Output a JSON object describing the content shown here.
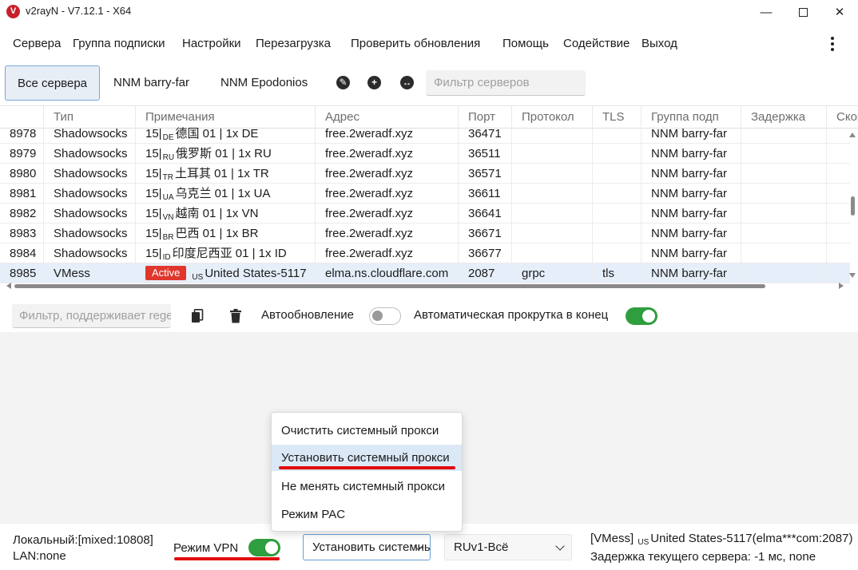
{
  "window": {
    "title": "v2rayN - V7.12.1 - X64",
    "logo_glyph": "V",
    "minimize": "—",
    "close": "✕"
  },
  "menu": {
    "items": [
      "Сервера",
      "Группа подписки",
      "Настройки",
      "Перезагрузка",
      "Проверить обновления",
      "Помощь",
      "Содействие",
      "Выход"
    ]
  },
  "tabs": {
    "items": [
      "Все сервера",
      "NNM barry-far",
      "NNM Epodonios"
    ],
    "active_index": 0,
    "filter_placeholder": "Фильтр серверов"
  },
  "grid": {
    "columns": [
      "Тип",
      "Примечания",
      "Адрес",
      "Порт",
      "Протокол",
      "TLS",
      "Группа подп",
      "Задержка",
      "Скорость"
    ],
    "rows": [
      {
        "n": "8978",
        "type": "Shadowsocks",
        "prefix": "15|",
        "cc": "DE",
        "name": "德国 01 | 1x DE",
        "addr": "free.2weradf.xyz",
        "port": "36471",
        "proto": "",
        "tls": "",
        "group": "NNM barry-far"
      },
      {
        "n": "8979",
        "type": "Shadowsocks",
        "prefix": "15|",
        "cc": "RU",
        "name": "俄罗斯 01 | 1x RU",
        "addr": "free.2weradf.xyz",
        "port": "36511",
        "proto": "",
        "tls": "",
        "group": "NNM barry-far"
      },
      {
        "n": "8980",
        "type": "Shadowsocks",
        "prefix": "15|",
        "cc": "TR",
        "name": "土耳其 01 | 1x TR",
        "addr": "free.2weradf.xyz",
        "port": "36571",
        "proto": "",
        "tls": "",
        "group": "NNM barry-far"
      },
      {
        "n": "8981",
        "type": "Shadowsocks",
        "prefix": "15|",
        "cc": "UA",
        "name": "乌克兰 01 | 1x UA",
        "addr": "free.2weradf.xyz",
        "port": "36611",
        "proto": "",
        "tls": "",
        "group": "NNM barry-far"
      },
      {
        "n": "8982",
        "type": "Shadowsocks",
        "prefix": "15|",
        "cc": "VN",
        "name": "越南 01 | 1x VN",
        "addr": "free.2weradf.xyz",
        "port": "36641",
        "proto": "",
        "tls": "",
        "group": "NNM barry-far"
      },
      {
        "n": "8983",
        "type": "Shadowsocks",
        "prefix": "15|",
        "cc": "BR",
        "name": "巴西 01 | 1x BR",
        "addr": "free.2weradf.xyz",
        "port": "36671",
        "proto": "",
        "tls": "",
        "group": "NNM barry-far"
      },
      {
        "n": "8984",
        "type": "Shadowsocks",
        "prefix": "15|",
        "cc": "ID",
        "name": "印度尼西亚 01 | 1x ID",
        "addr": "free.2weradf.xyz",
        "port": "36677",
        "proto": "",
        "tls": "",
        "group": "NNM barry-far"
      }
    ],
    "selected_row": {
      "n": "8985",
      "type": "VMess",
      "badge": "Active",
      "cc": "US",
      "name": "United States-5117",
      "addr": "elma.ns.cloudflare.com",
      "port": "2087",
      "proto": "grpc",
      "tls": "tls",
      "group": "NNM barry-far"
    }
  },
  "log_toolbar": {
    "filter_placeholder": "Фильтр, поддерживает regex",
    "auto_refresh_label": "Автообновление",
    "auto_refresh_on": false,
    "auto_scroll_label": "Автоматическая прокрутка в конец",
    "auto_scroll_on": true
  },
  "popup": {
    "items": [
      "Очистить системный прокси",
      "Установить системный прокси",
      "Не менять системный прокси",
      "Режим PAC"
    ],
    "highlighted_index": 1
  },
  "status": {
    "local": "Локальный:[mixed:10808]",
    "lan": "LAN:none",
    "vpn_label": "Режим VPN",
    "vpn_on": true,
    "proxy_mode_value": "Установить системный прокси",
    "routing_value": "RUv1-Всё",
    "server_prefix": "[VMess]",
    "server_cc": "US",
    "server_name": "United States-5117(elma***com:2087)",
    "latency": "Задержка текущего сервера: -1 мс, none"
  },
  "colors": {
    "accent": "#2e9e3e",
    "active_badge": "#e0362c",
    "annotation_red": "#e20d0d",
    "selection": "#e5eef9"
  }
}
